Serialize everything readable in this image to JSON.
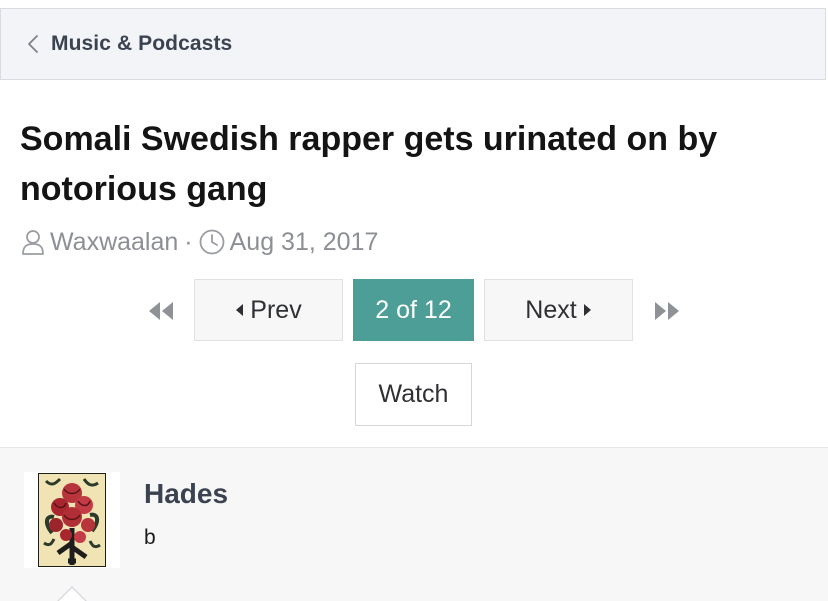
{
  "breadcrumb": {
    "label": "Music & Podcasts",
    "icon": "chevron-left-icon"
  },
  "thread": {
    "title": "Somali Swedish rapper gets urinated on by notorious gang",
    "author": "Waxwaalan",
    "separator": "·",
    "date": "Aug 31, 2017"
  },
  "pagination": {
    "prev_label": "Prev",
    "current_label": "2 of 12",
    "next_label": "Next",
    "current_page": 2,
    "total_pages": 12,
    "accent_color": "#4c9e96"
  },
  "actions": {
    "watch_label": "Watch"
  },
  "post": {
    "username": "Hades",
    "user_title": "b"
  }
}
